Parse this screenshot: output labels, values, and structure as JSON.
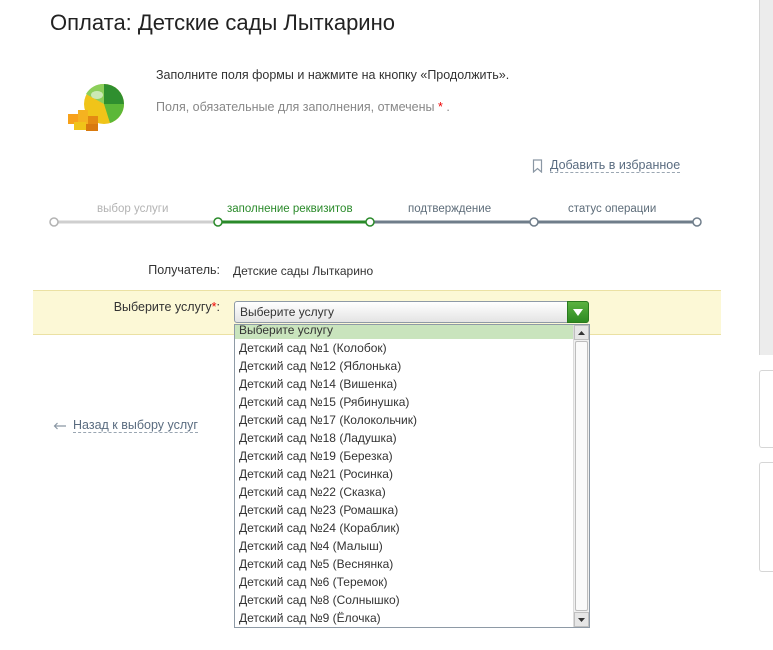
{
  "page": {
    "title": "Оплата: Детские сады Лыткарино"
  },
  "instructions": {
    "line1": "Заполните поля формы и нажмите на кнопку «Продолжить».",
    "line2": "Поля, обязательные для заполнения, отмечены",
    "required_mark": "*",
    "line2_end": "."
  },
  "favorites": {
    "label": "Добавить в избранное",
    "icon": "bookmark-icon"
  },
  "steps": [
    {
      "label": "выбор услуги",
      "state": "done"
    },
    {
      "label": "заполнение реквизитов",
      "state": "active"
    },
    {
      "label": "подтверждение",
      "state": "pending"
    },
    {
      "label": "статус операции",
      "state": "pending"
    }
  ],
  "form": {
    "recipient_label": "Получатель:",
    "recipient_value": "Детские сады Лыткарино",
    "service_label": "Выберите услугу",
    "service_label_colon": ":",
    "required_mark": "*",
    "service_selected": "Выберите услугу",
    "service_options": [
      "Выберите услугу",
      "Детский сад №1 (Колобок)",
      "Детский сад №12 (Яблонька)",
      "Детский сад №14 (Вишенка)",
      "Детский сад №15 (Рябинушка)",
      "Детский сад №17 (Колокольчик)",
      "Детский сад №18 (Ладушка)",
      "Детский сад №19 (Березка)",
      "Детский сад №21 (Росинка)",
      "Детский сад №22 (Сказка)",
      "Детский сад №23 (Ромашка)",
      "Детский сад №24 (Кораблик)",
      "Детский сад №4 (Малыш)",
      "Детский сад №5 (Веснянка)",
      "Детский сад №6 (Теремок)",
      "Детский сад №8 (Солнышко)",
      "Детский сад №9 (Ёлочка)"
    ]
  },
  "back": {
    "label": "Назад к выбору услуг",
    "icon": "arrow-left-icon"
  },
  "colors": {
    "accent_green": "#2a8a2a",
    "highlight_row": "#fcf8d6",
    "link": "#5a6c80"
  }
}
